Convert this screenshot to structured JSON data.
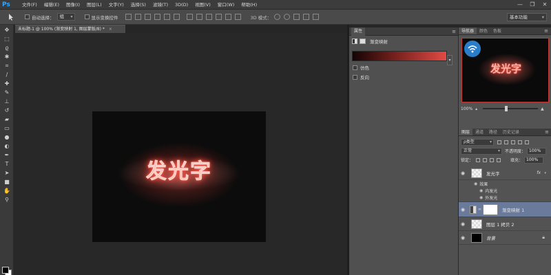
{
  "app": {
    "logo": "Ps"
  },
  "menu": [
    "文件(F)",
    "编辑(E)",
    "图像(I)",
    "图层(L)",
    "文字(Y)",
    "选择(S)",
    "滤镜(T)",
    "3D(D)",
    "视图(V)",
    "窗口(W)",
    "帮助(H)"
  ],
  "window_controls": {
    "minimize": "—",
    "restore": "❐",
    "close": "✕"
  },
  "options": {
    "auto_select_label": "自动选择：",
    "auto_select_value": "组",
    "transform_label": "显示变换控件",
    "mode_3d_label": "3D 模式：",
    "workspace": "基本功能"
  },
  "document": {
    "tab_title": "未标题-1 @ 100% (渐变映射 1, 图层蒙版/8) *",
    "tab_close": "×",
    "canvas_text": "发光字"
  },
  "properties": {
    "tab": "属性",
    "adjustment_name": "渐变映射",
    "gradient_colors": [
      "#120505",
      "#6b1d1a",
      "#e24a44"
    ],
    "options": [
      {
        "label": "仿色",
        "checked": false
      },
      {
        "label": "反向",
        "checked": false
      }
    ]
  },
  "navigator": {
    "tabs": [
      "导航器",
      "颜色",
      "色板"
    ],
    "zoom": "100%",
    "preview_text": "发光字"
  },
  "layers_panel": {
    "tabs": [
      "图层",
      "通道",
      "路径",
      "历史记录"
    ],
    "filter_kind": "ρ类型",
    "blend_mode": "正常",
    "opacity_label": "不透明度：",
    "opacity_value": "100%",
    "lock_label": "锁定：",
    "fill_label": "填充：",
    "fill_value": "100%",
    "layers": [
      {
        "name": "发光字",
        "fx": "fx",
        "effects_label": "效果",
        "effects": [
          "内发光",
          "外发光"
        ]
      },
      {
        "name": "渐变映射 1",
        "selected": true
      },
      {
        "name": "图层 1 拷贝 2"
      },
      {
        "name": "背景",
        "locked": true
      }
    ]
  }
}
